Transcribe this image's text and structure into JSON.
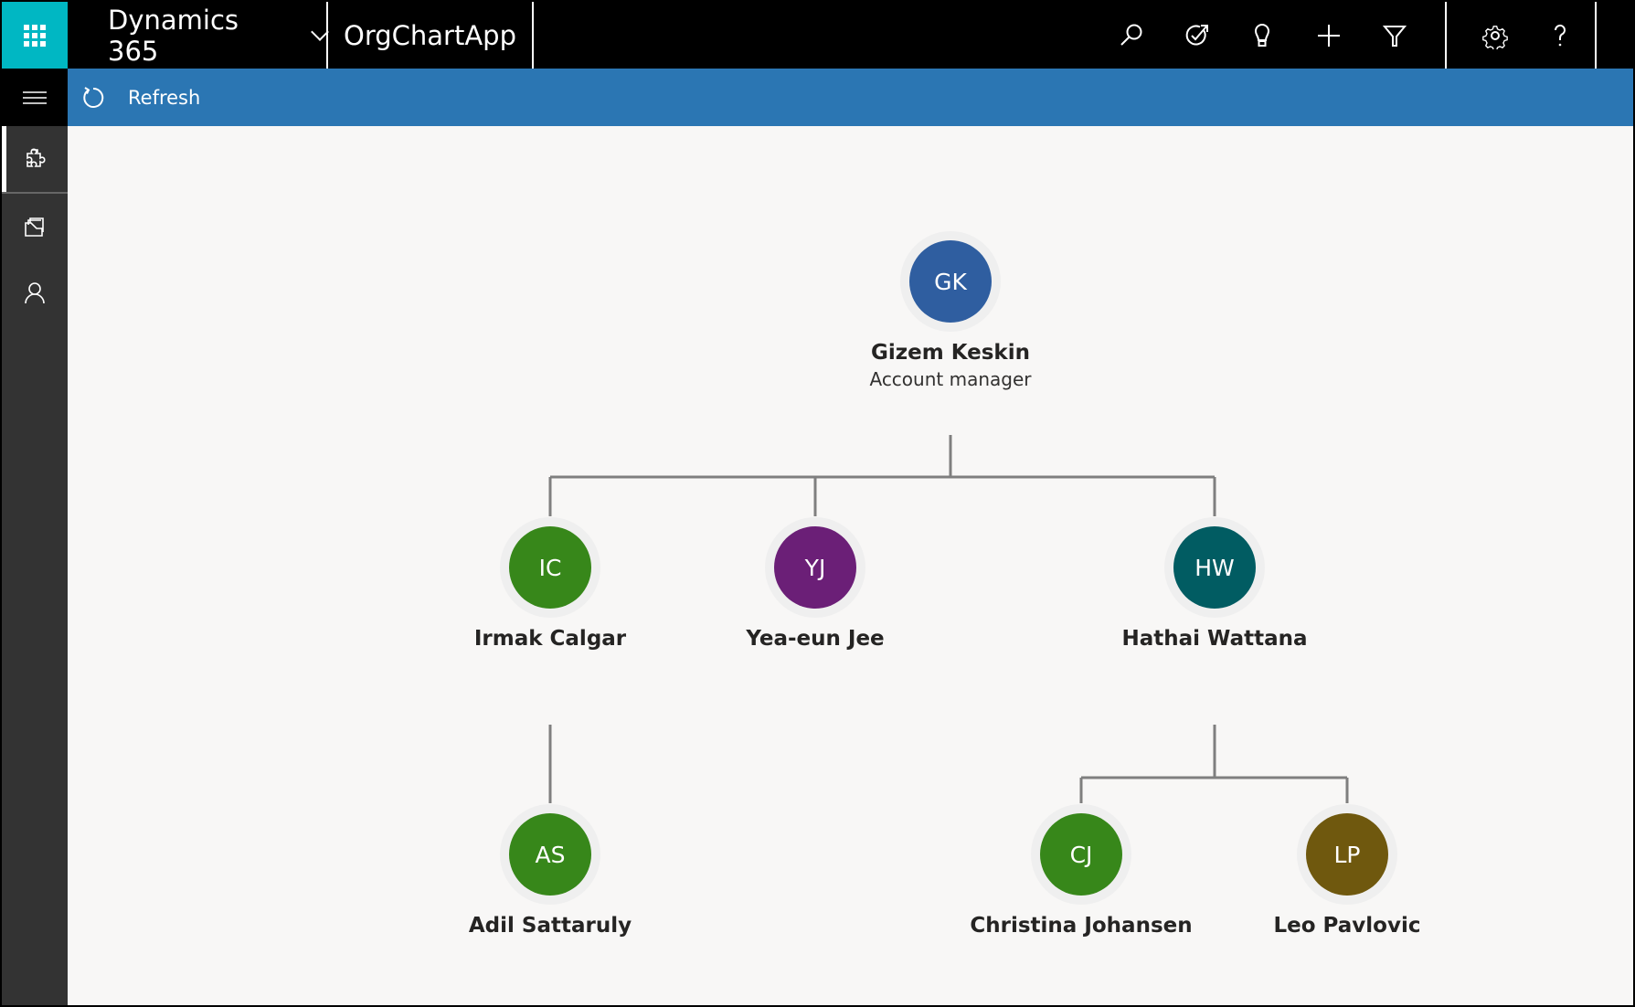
{
  "header": {
    "brand": "Dynamics 365",
    "app_name": "OrgChartApp",
    "icons": [
      {
        "name": "search-icon",
        "label": "Search"
      },
      {
        "name": "task-icon",
        "label": "Task flow"
      },
      {
        "name": "lightbulb-icon",
        "label": "Relationship insights"
      },
      {
        "name": "plus-icon",
        "label": "Create"
      },
      {
        "name": "filter-icon",
        "label": "Advanced find"
      },
      {
        "name": "gear-icon",
        "label": "Settings"
      },
      {
        "name": "help-icon",
        "label": "Help"
      }
    ]
  },
  "command_bar": {
    "refresh_label": "Refresh"
  },
  "sidebar": {
    "items": [
      {
        "name": "puzzle-icon",
        "active": true
      },
      {
        "name": "folder-icon",
        "active": false
      },
      {
        "name": "person-icon",
        "active": false
      }
    ]
  },
  "org_chart": {
    "nodes": [
      {
        "id": "gk",
        "initials": "GK",
        "name": "Gizem Keskin",
        "title": "Account manager",
        "color": "#2f5ea0",
        "parent": null
      },
      {
        "id": "ic",
        "initials": "IC",
        "name": "Irmak Calgar",
        "title": "",
        "color": "#37871a",
        "parent": "gk"
      },
      {
        "id": "yj",
        "initials": "YJ",
        "name": "Yea-eun Jee",
        "title": "",
        "color": "#6b1f77",
        "parent": "gk"
      },
      {
        "id": "hw",
        "initials": "HW",
        "name": "Hathai Wattana",
        "title": "",
        "color": "#015c62",
        "parent": "gk"
      },
      {
        "id": "as",
        "initials": "AS",
        "name": "Adil Sattaruly",
        "title": "",
        "color": "#37871a",
        "parent": "ic"
      },
      {
        "id": "cj",
        "initials": "CJ",
        "name": "Christina Johansen",
        "title": "",
        "color": "#37871a",
        "parent": "hw"
      },
      {
        "id": "lp",
        "initials": "LP",
        "name": "Leo Pavlovic",
        "title": "",
        "color": "#6f580e",
        "parent": "hw"
      }
    ],
    "connector_color": "#7f7f7f",
    "halo_color": "#efefef"
  }
}
